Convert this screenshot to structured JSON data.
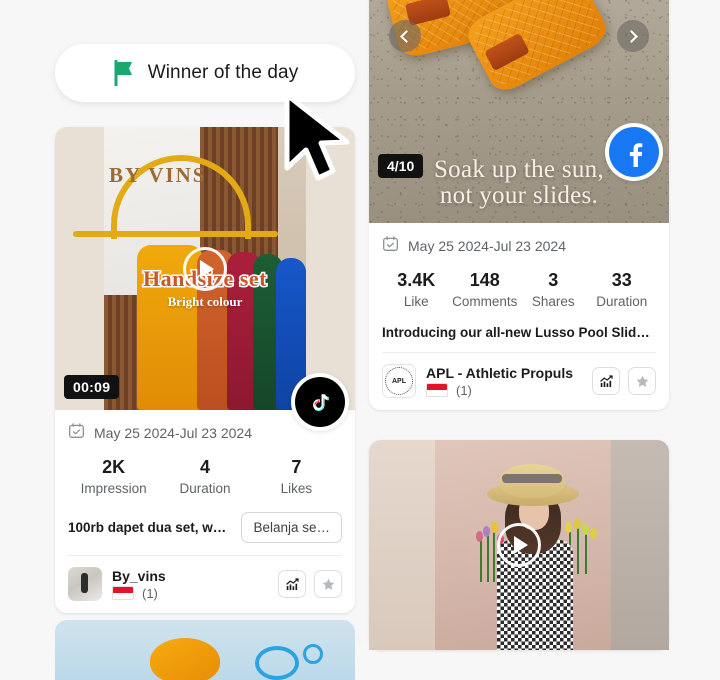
{
  "badge": {
    "winner_label": "Winner of the day",
    "flag_icon": "green-flag-icon",
    "flag_color": "#1aa86f"
  },
  "cursor": {
    "icon": "mouse-pointer-icon"
  },
  "cards": {
    "left": {
      "platform": "tiktok",
      "platform_icon": "tiktok-icon",
      "duration_chip": "00:09",
      "play_icon": "play-icon",
      "media_overlay_line1": "Handsize set",
      "media_overlay_line2": "Bright colour",
      "media_brand_text": "BY VINS",
      "calendar_icon": "calendar-check-icon",
      "date_range": "May 25 2024-Jul 23 2024",
      "stats": [
        {
          "value": "2K",
          "label": "Impression"
        },
        {
          "value": "4",
          "label": "Duration"
        },
        {
          "value": "7",
          "label": "Likes"
        }
      ],
      "title": "100rb dapet dua set, war…",
      "cta_label": "Belanja se…",
      "author": {
        "name": "By_vins",
        "avatar_icon": "author-avatar",
        "country_flag": "indonesia-flag-icon",
        "count": "(1)"
      },
      "actions": [
        {
          "icon": "analytics-chart-icon"
        },
        {
          "icon": "star-icon"
        }
      ]
    },
    "right": {
      "platform": "facebook",
      "platform_icon": "facebook-icon",
      "counter_chip": "4/10",
      "prev_icon": "chevron-left-icon",
      "next_icon": "chevron-right-icon",
      "headline_line1": "Soak up the sun,",
      "headline_line2": "not your slides.",
      "calendar_icon": "calendar-check-icon",
      "date_range": "May 25 2024-Jul 23 2024",
      "stats": [
        {
          "value": "3.4K",
          "label": "Like"
        },
        {
          "value": "148",
          "label": "Comments"
        },
        {
          "value": "3",
          "label": "Shares"
        },
        {
          "value": "33",
          "label": "Duration"
        }
      ],
      "title": "Introducing our all-new Lusso Pool Slide…",
      "author": {
        "name": "APL - Athletic Propuls",
        "avatar_icon": "apl-logo-avatar",
        "avatar_text": "APL",
        "country_flag": "indonesia-flag-icon",
        "count": "(1)"
      },
      "actions": [
        {
          "icon": "analytics-chart-icon"
        },
        {
          "icon": "star-icon"
        }
      ]
    },
    "right_bottom": {
      "play_icon": "play-icon"
    },
    "left_bottom": {
      "partial": true
    }
  },
  "colors": {
    "page_bg": "#f7f7f7",
    "card_bg": "#ffffff",
    "text_primary": "#1b1b1b",
    "text_secondary": "#5f6368",
    "chip_bg": "#111111",
    "facebook_blue": "#1877f2",
    "tiktok_black": "#000000",
    "flag_green": "#1aa86f"
  }
}
